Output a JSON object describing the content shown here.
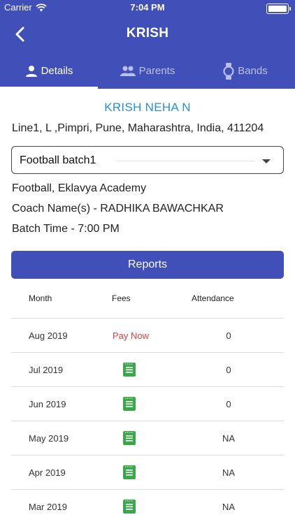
{
  "status_bar": {
    "carrier": "Carrier",
    "time": "7:04 PM"
  },
  "nav": {
    "title": "KRISH"
  },
  "tabs": [
    {
      "label": "Details",
      "icon": "person-icon",
      "active": true
    },
    {
      "label": "Parents",
      "icon": "people-icon",
      "active": false
    },
    {
      "label": "Bands",
      "icon": "watch-icon",
      "active": false
    }
  ],
  "student": {
    "name": "KRISH NEHA N",
    "address": "Line1, L ,Pimpri, Pune, Maharashtra, India, 411204"
  },
  "batch": {
    "selected": "Football batch1",
    "sport_academy": "Football, Eklavya Academy",
    "coach": "Coach Name(s) - RADHIKA BAWACHKAR",
    "time": "Batch Time - 7:00 PM"
  },
  "reports_button": "Reports",
  "table": {
    "headers": {
      "month": "Month",
      "fees": "Fees",
      "attendance": "Attendance"
    },
    "rows": [
      {
        "month": "Aug 2019",
        "fees": "Pay Now",
        "attendance": "0"
      },
      {
        "month": "Jul 2019",
        "fees_icon": "receipt-icon",
        "attendance": "0"
      },
      {
        "month": "Jun 2019",
        "fees_icon": "receipt-icon",
        "attendance": "0"
      },
      {
        "month": "May 2019",
        "fees_icon": "receipt-icon",
        "attendance": "NA"
      },
      {
        "month": "Apr 2019",
        "fees_icon": "receipt-icon",
        "attendance": "NA"
      },
      {
        "month": "Mar 2019",
        "fees_icon": "receipt-icon",
        "attendance": "NA"
      }
    ]
  },
  "colors": {
    "primary": "#4150b8",
    "name_blue": "#2a8fd8",
    "pay_now_red": "#d9413f",
    "receipt_green": "#3aa84a"
  }
}
